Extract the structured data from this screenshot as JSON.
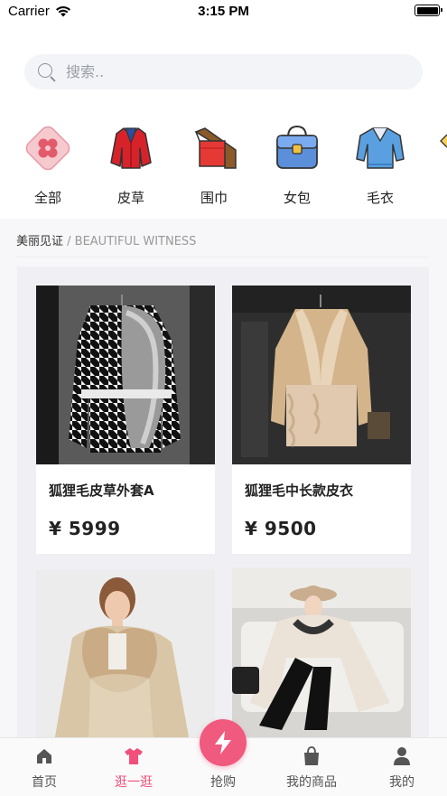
{
  "status_bar": {
    "carrier": "Carrier",
    "time": "3:15 PM"
  },
  "search": {
    "placeholder": "搜索.."
  },
  "categories": [
    {
      "label": "全部",
      "icon": "flower-icon"
    },
    {
      "label": "皮草",
      "icon": "fur-coat-icon"
    },
    {
      "label": "围巾",
      "icon": "scarf-icon"
    },
    {
      "label": "女包",
      "icon": "handbag-icon"
    },
    {
      "label": "毛衣",
      "icon": "sweater-icon"
    }
  ],
  "section": {
    "title": "美丽见证",
    "subtitle": " / BEAUTIFUL WITNESS"
  },
  "products": [
    {
      "name": "狐狸毛皮草外套A",
      "price": "¥ 5999"
    },
    {
      "name": "狐狸毛中长款皮衣",
      "price": "¥ 9500"
    },
    {
      "name": "",
      "price": ""
    },
    {
      "name": "",
      "price": ""
    }
  ],
  "tabbar": {
    "items": [
      {
        "label": "首页",
        "icon": "home-icon"
      },
      {
        "label": "逛一逛",
        "icon": "shirt-icon"
      },
      {
        "label": "抢购",
        "icon": "lightning-icon"
      },
      {
        "label": "我的商品",
        "icon": "bag-icon"
      },
      {
        "label": "我的",
        "icon": "user-icon"
      }
    ],
    "active_index": 1
  },
  "colors": {
    "accent": "#f05a7e",
    "active_tab": "#f0507a"
  }
}
